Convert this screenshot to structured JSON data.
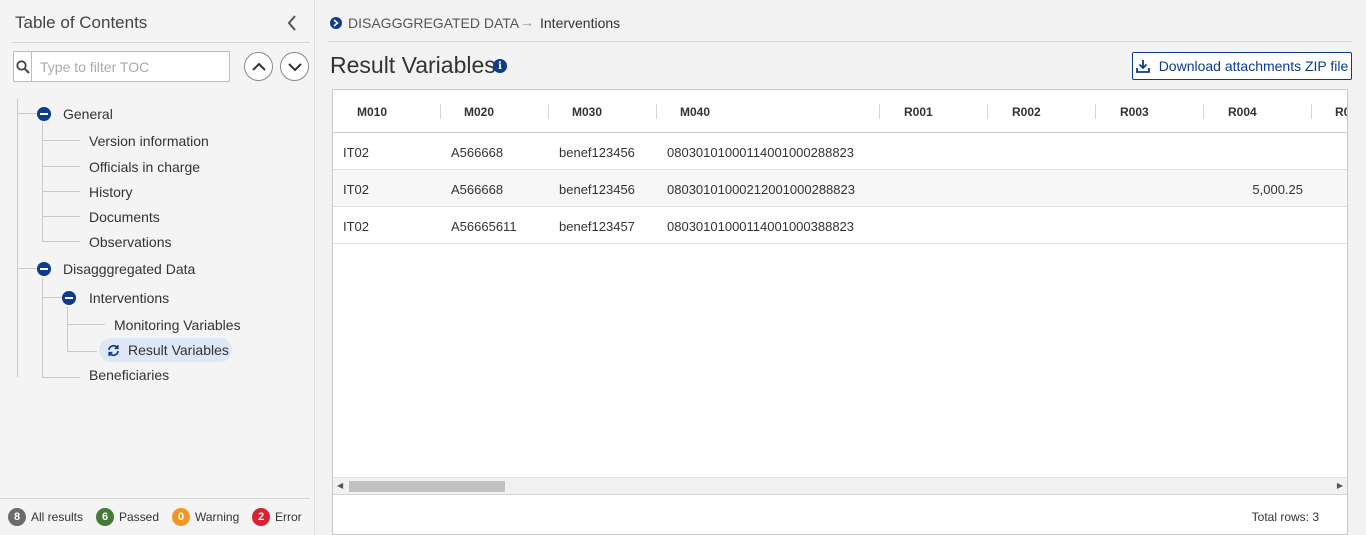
{
  "toc": {
    "title": "Table of Contents",
    "filter_placeholder": "Type to filter TOC",
    "items": [
      {
        "label": "General"
      },
      {
        "label": "Version information"
      },
      {
        "label": "Officials in charge"
      },
      {
        "label": "History"
      },
      {
        "label": "Documents"
      },
      {
        "label": "Observations"
      },
      {
        "label": "Disagggregated Data"
      },
      {
        "label": "Interventions"
      },
      {
        "label": "Monitoring Variables"
      },
      {
        "label": "Result Variables"
      },
      {
        "label": "Beneficiaries"
      }
    ],
    "status": [
      {
        "count": "8",
        "label": "All results",
        "color": "#6b6b6b"
      },
      {
        "count": "6",
        "label": "Passed",
        "color": "#467a39"
      },
      {
        "count": "0",
        "label": "Warning",
        "color": "#f29527"
      },
      {
        "count": "2",
        "label": "Error",
        "color": "#da2131"
      }
    ]
  },
  "breadcrumb": {
    "parent": "DISAGGGREGATED DATA",
    "current": "Interventions"
  },
  "page": {
    "title": "Result Variables",
    "download_label": "Download attachments ZIP file"
  },
  "table": {
    "columns": [
      "M010",
      "M020",
      "M030",
      "M040",
      "R001",
      "R002",
      "R003",
      "R004",
      "R0"
    ],
    "rows": [
      [
        "IT02",
        "A566668",
        "benef123456",
        "080301010001140010002888 23",
        "",
        "",
        "",
        ""
      ],
      [
        "IT02",
        "A566668",
        "benef123456",
        "08030101000212001000288823",
        "",
        "",
        "",
        "5,000.25"
      ],
      [
        "IT02",
        "A56665611",
        "benef123457",
        "08030101000114001000388823",
        "",
        "",
        "",
        ""
      ]
    ],
    "total_rows": "Total rows: 3"
  },
  "colors": {
    "accent": "#0e3b8c"
  }
}
